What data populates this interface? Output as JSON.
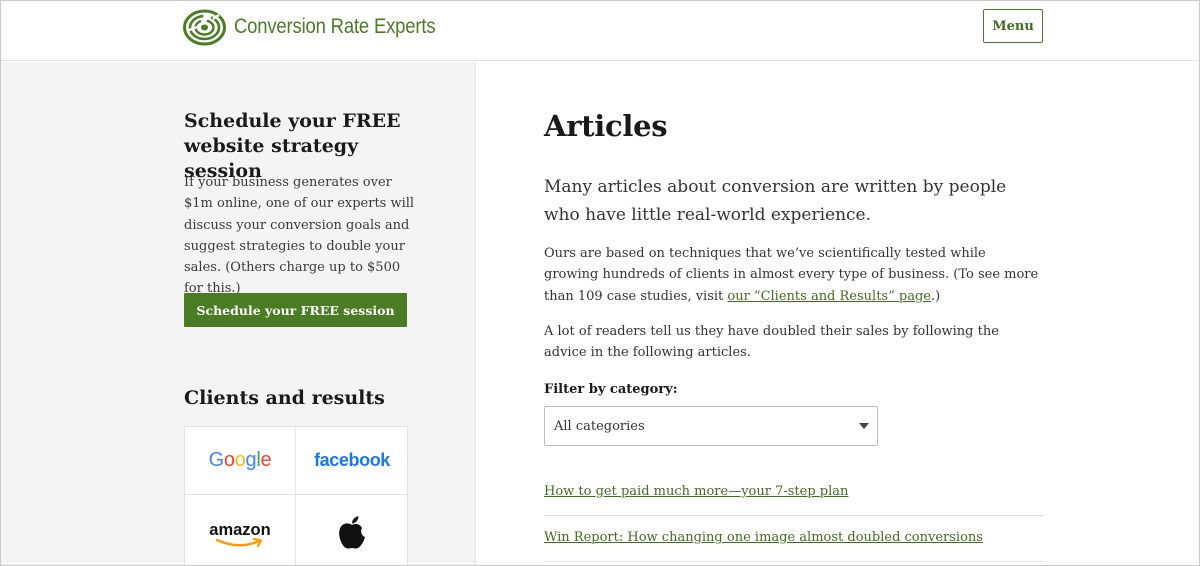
{
  "header": {
    "brand": "Conversion Rate Experts",
    "menu_label": "Menu"
  },
  "sidebar": {
    "cta_title": "Schedule your FREE website strategy session",
    "cta_text": "If your business generates over $1m online, one of our experts will discuss your conversion goals and suggest strategies to double your sales. (Others charge up to $500 for this.)",
    "cta_button": "Schedule your FREE session",
    "clients_title": "Clients and results",
    "client_logos": [
      "Google",
      "facebook",
      "amazon",
      "apple"
    ]
  },
  "main": {
    "title": "Articles",
    "lead": "Many articles about conversion are written by people who have little real-world experience.",
    "para1_text": "Ours are based on techniques that we’ve scientifically tested while growing hundreds of clients in almost every type of business. (To see more than 109 case studies, visit ",
    "para1_link": "our “Clients and Results” page",
    "para1_end": ".)",
    "para2": "A lot of readers tell us they have doubled their sales by following the advice in the following articles.",
    "filter_label": "Filter by category:",
    "filter_value": "All categories",
    "articles": [
      "How to get paid much more—your 7-step plan",
      "Win Report: How changing one image almost doubled conversions"
    ]
  },
  "colors": {
    "brand_green": "#4a7c23",
    "link_green": "#3f6d1d",
    "sidebar_bg": "#f4f4f4",
    "facebook_blue": "#1877f2"
  }
}
